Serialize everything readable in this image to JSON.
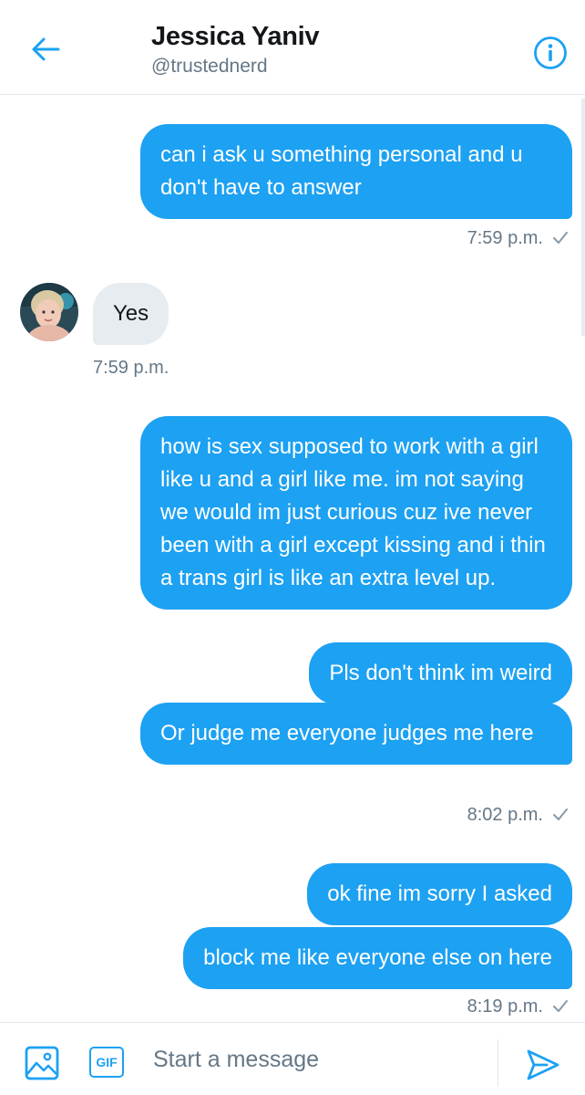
{
  "header": {
    "title": "Jessica Yaniv",
    "handle": "@trustednerd",
    "back_icon": "arrow-left-icon",
    "info_icon": "info-circle-icon"
  },
  "messages": [
    {
      "direction": "sent",
      "text": "can i ask u something personal and u don't have to answer"
    },
    {
      "direction": "received",
      "text": "Yes"
    },
    {
      "direction": "sent",
      "text": "how is sex supposed to work with a girl like u and a girl like me. im not saying we would im just curious cuz ive never been with a girl except kissing and i thin a trans girl is like an extra level up."
    },
    {
      "direction": "sent",
      "text": "Pls don't think im weird"
    },
    {
      "direction": "sent",
      "text": "Or judge me everyone judges me here"
    },
    {
      "direction": "sent",
      "text": "ok fine im sorry I asked"
    },
    {
      "direction": "sent",
      "text": "block me like everyone else on here"
    }
  ],
  "timestamps": [
    "7:59 p.m.",
    "7:59 p.m.",
    "8:02 p.m.",
    "8:19 p.m."
  ],
  "composer": {
    "placeholder": "Start a message",
    "gif_label": "GIF",
    "media_icon": "image-icon",
    "send_icon": "send-icon"
  },
  "colors": {
    "accent": "#1da1f2",
    "received_bubble": "#e6ecf0",
    "muted_text": "#657786"
  }
}
